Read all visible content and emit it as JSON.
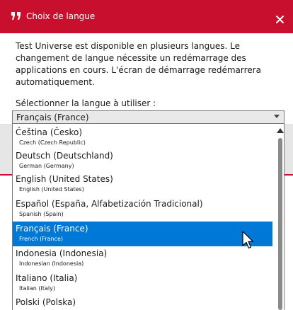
{
  "dialog": {
    "title": "Choix de langue",
    "title_icon": "quote-icon",
    "close_label": "X",
    "description": "Test Universe est disponible en plusieurs langues. Le changement de langue nécessite un redémarrage des applications en cours. L'écran de démarrage redémarrera automatiquement.",
    "select_label": "Sélectionner la langue à utiliser :",
    "selected_value": "Français (France)"
  },
  "languages": [
    {
      "name": "Čeština (Česko)",
      "sub": "Czech (Czech Republic)",
      "selected": false
    },
    {
      "name": "Deutsch (Deutschland)",
      "sub": "German (Germany)",
      "selected": false
    },
    {
      "name": "English (United States)",
      "sub": "English (United States)",
      "selected": false
    },
    {
      "name": "Español (España, Alfabetización Tradicional)",
      "sub": "Spanish (Spain)",
      "selected": false
    },
    {
      "name": "Français (France)",
      "sub": "French (France)",
      "selected": true
    },
    {
      "name": "Indonesia (Indonesia)",
      "sub": "Indonesian (Indonesia)",
      "selected": false
    },
    {
      "name": "Italiano (Italia)",
      "sub": "Italian (Italy)",
      "selected": false
    },
    {
      "name": "Polski (Polska)",
      "sub": "",
      "selected": false
    }
  ],
  "colors": {
    "titlebar": "#c8102e",
    "selection": "#0078d7"
  }
}
